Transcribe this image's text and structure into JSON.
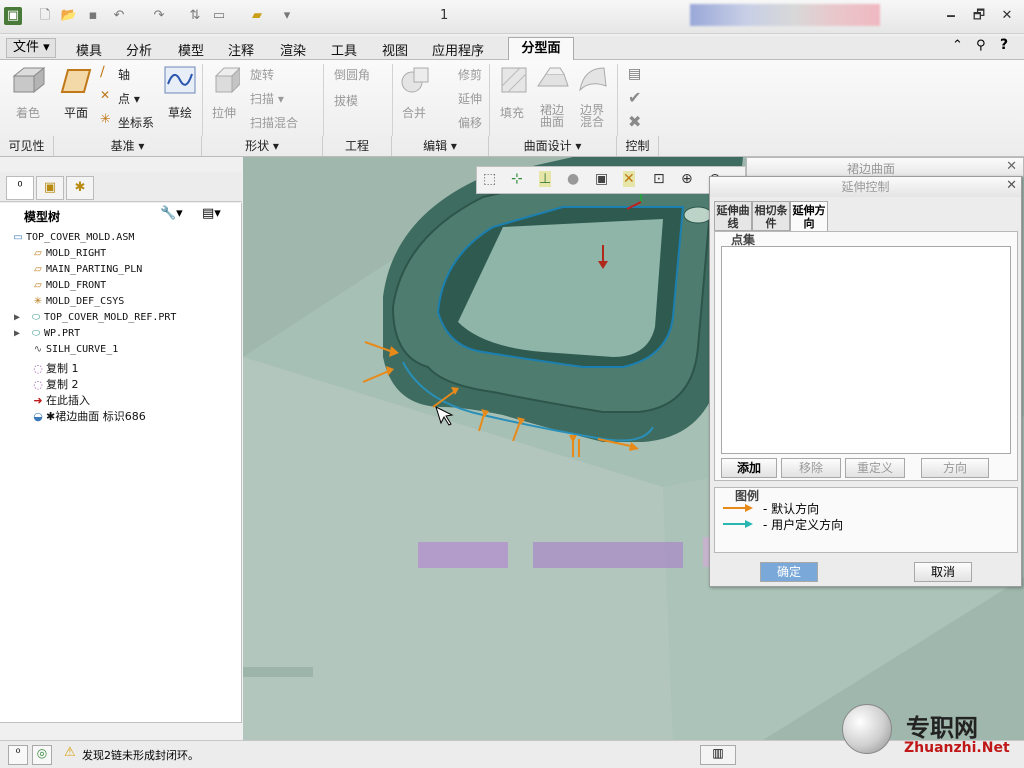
{
  "window": {
    "title": "1",
    "minimize": "🗕",
    "restore": "🗗",
    "close": "✕"
  },
  "menu": {
    "file": "文件 ▾",
    "tabs": [
      "模具",
      "分析",
      "模型",
      "注释",
      "渲染",
      "工具",
      "视图",
      "应用程序"
    ],
    "active_tab": "分型面",
    "right_icons": [
      "⌃",
      "ⓘ",
      "⚲",
      "?"
    ]
  },
  "ribbon": {
    "visibility": {
      "shade": "着色",
      "group": "可见性"
    },
    "datum": {
      "plane": "平面",
      "axis": "轴",
      "point": "点 ▾",
      "csys": "坐标系",
      "sketch": "草绘",
      "group": "基准 ▾"
    },
    "shapes": {
      "extrude": "拉伸",
      "revolve": "旋转",
      "sweep": "扫描 ▾",
      "swept_blend": "扫描混合",
      "group": "形状 ▾"
    },
    "engineering": {
      "round": "倒圆角",
      "draft": "拔模",
      "group": "工程"
    },
    "editing": {
      "merge": "合并",
      "trim": "修剪",
      "extend": "延伸",
      "offset": "偏移",
      "group": "编辑 ▾"
    },
    "surface_design": {
      "fill": "填充",
      "skirt": "裙边曲面",
      "boundary_blend": "边界混合",
      "group": "曲面设计 ▾"
    },
    "control": {
      "group": "控制"
    }
  },
  "model_tree": {
    "tab_icons": [
      "⁰",
      "▣",
      "✱"
    ],
    "header": "模型树",
    "items": [
      {
        "icon": "▭",
        "label": "TOP_COVER_MOLD.ASM"
      },
      {
        "icon": "▱",
        "label": "MOLD_RIGHT"
      },
      {
        "icon": "▱",
        "label": "MAIN_PARTING_PLN"
      },
      {
        "icon": "▱",
        "label": "MOLD_FRONT"
      },
      {
        "icon": "✳",
        "label": "MOLD_DEF_CSYS"
      },
      {
        "icon": "⬭",
        "label": "TOP_COVER_MOLD_REF.PRT"
      },
      {
        "icon": "⬭",
        "label": "WP.PRT"
      },
      {
        "icon": "∿",
        "label": "SILH_CURVE_1"
      },
      {
        "icon": "◌",
        "label": "复制 1"
      },
      {
        "icon": "◌",
        "label": "复制 2"
      },
      {
        "icon": "➜",
        "label": "在此插入"
      },
      {
        "icon": "◒",
        "label": "✱裙边曲面 标识686"
      }
    ]
  },
  "back_dialog": {
    "title": "裙边曲面",
    "close": "✕"
  },
  "dialog": {
    "title": "延伸控制",
    "close": "✕",
    "tabs": [
      "延伸曲线",
      "相切条件",
      "延伸方向"
    ],
    "point_set_label": "点集",
    "buttons": {
      "add": "添加",
      "remove": "移除",
      "redefine": "重定义",
      "direction": "方向"
    },
    "legend_label": "图例",
    "legend": [
      {
        "text": "- 默认方向",
        "color": "#e88a1a"
      },
      {
        "text": "- 用户定义方向",
        "color": "#2ab6b0"
      }
    ],
    "ok": "确定",
    "cancel": "取消"
  },
  "status": {
    "message": "发现2链未形成封闭环。"
  },
  "watermark": {
    "cn": "专职网",
    "url": "Zhuanzhi.Net"
  },
  "colors": {
    "accent_blue": "#2a6fb5",
    "model_green": "#3d6b5e",
    "arrow_orange": "#e88a1a"
  }
}
